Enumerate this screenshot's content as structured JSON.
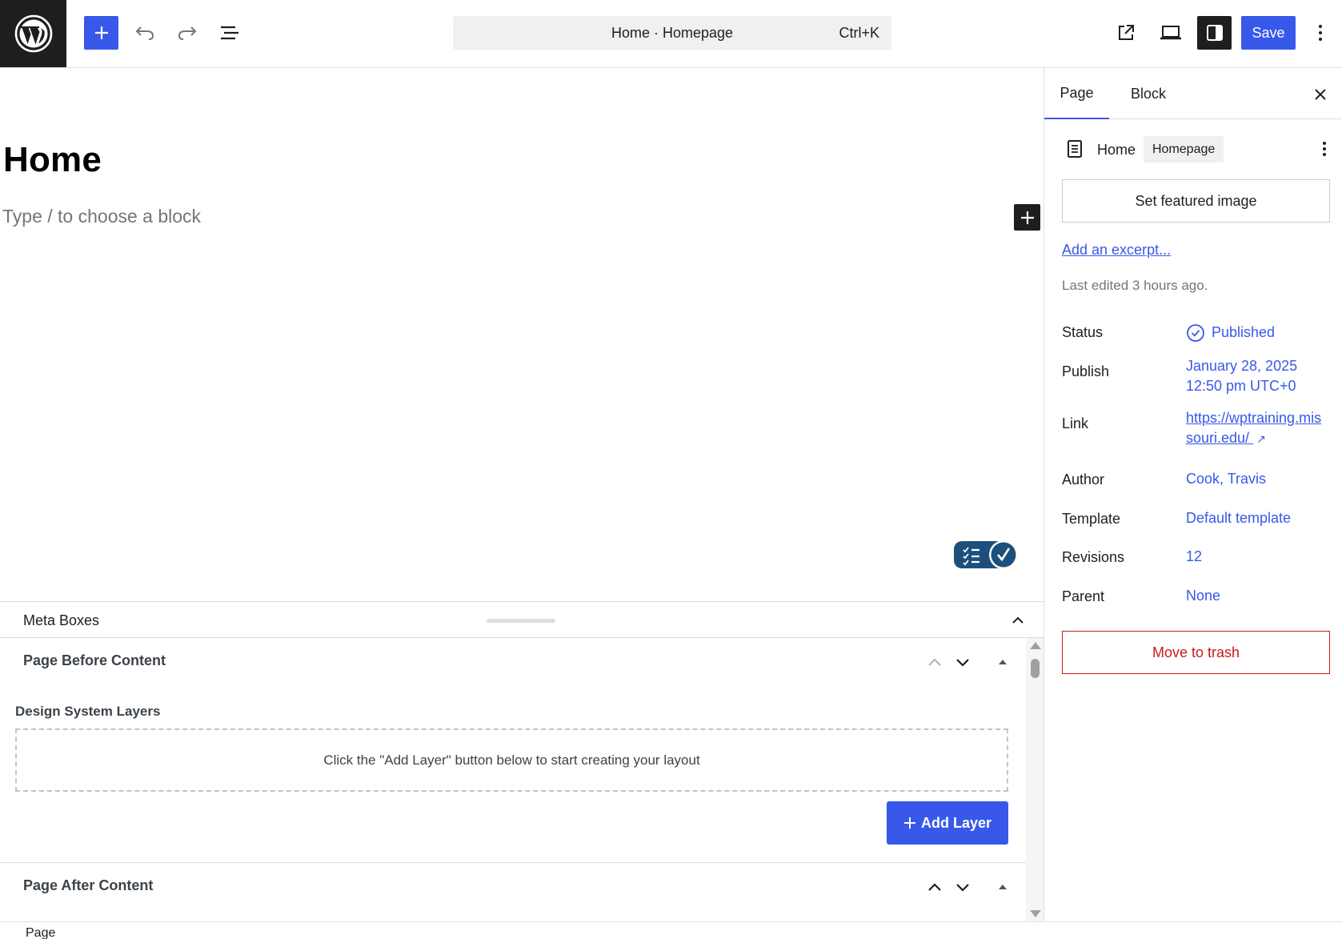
{
  "toolbar": {
    "command_title": "Home · Homepage",
    "command_shortcut": "Ctrl+K",
    "save_label": "Save"
  },
  "editor": {
    "title": "Home",
    "block_placeholder": "Type / to choose a block"
  },
  "meta_boxes": {
    "title": "Meta Boxes",
    "before": {
      "title": "Page Before Content",
      "layers_label": "Design System Layers",
      "empty_text": "Click the \"Add Layer\" button below to start creating your layout",
      "add_layer_label": "Add Layer"
    },
    "after": {
      "title": "Page After Content"
    }
  },
  "footer": {
    "breadcrumb": "Page"
  },
  "sidebar": {
    "tabs": [
      {
        "label": "Page",
        "active": true
      },
      {
        "label": "Block",
        "active": false
      }
    ],
    "page_name": "Home",
    "page_badge": "Homepage",
    "featured_image_label": "Set featured image",
    "excerpt_link": "Add an excerpt...",
    "last_edited": "Last edited 3 hours ago.",
    "props": {
      "status_label": "Status",
      "status_value": "Published",
      "publish_label": "Publish",
      "publish_date": "January 28, 2025",
      "publish_time": "12:50 pm UTC+0",
      "link_label": "Link",
      "link_value": "https://wptraining.missouri.edu/",
      "link_arrow": "↗",
      "author_label": "Author",
      "author_value": "Cook, Travis",
      "template_label": "Template",
      "template_value": "Default template",
      "revisions_label": "Revisions",
      "revisions_value": "12",
      "parent_label": "Parent",
      "parent_value": "None"
    },
    "trash_label": "Move to trash"
  },
  "colors": {
    "accent": "#3858e9",
    "dark": "#1e1e1e",
    "danger": "#cc1818",
    "a11y_toggle": "#1d4f7c"
  },
  "icons": {
    "logo": "wordpress-logo-icon",
    "inserter": "plus-icon",
    "undo": "undo-icon",
    "redo": "redo-icon",
    "list_view": "list-view-icon",
    "view": "external-link-icon",
    "preview": "desktop-preview-icon",
    "settings": "sidebar-settings-icon",
    "options": "more-vertical-icon"
  }
}
